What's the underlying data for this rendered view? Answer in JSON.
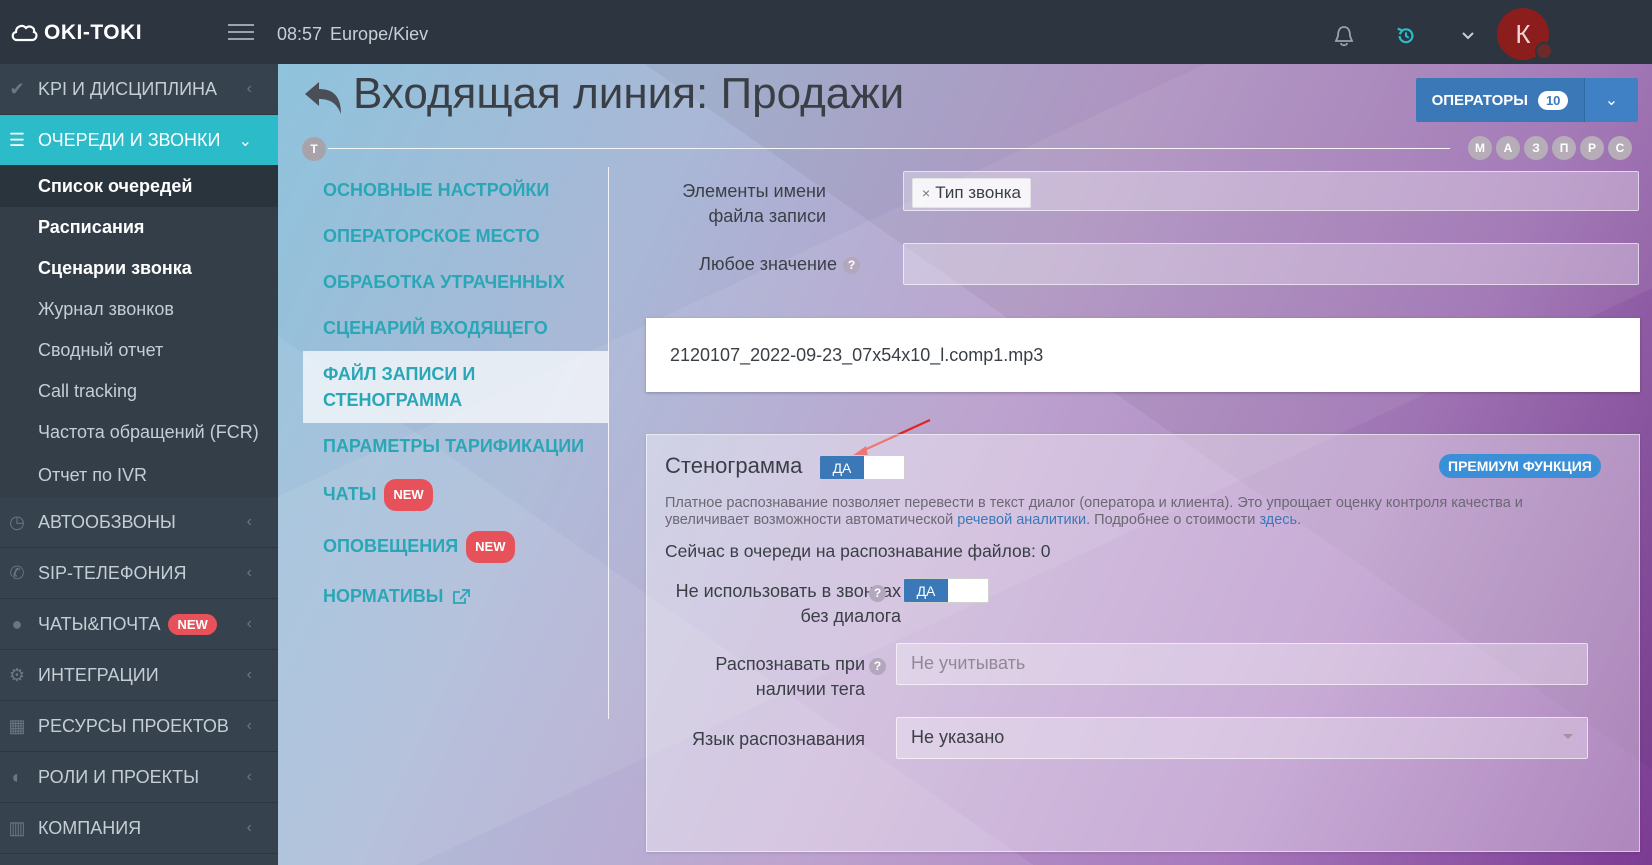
{
  "topbar": {
    "logo": "OKI-TOKI",
    "time": "08:57",
    "timezone": "Europe/Kiev",
    "avatar_letter": "К"
  },
  "sidebar": {
    "sections": [
      {
        "label": "KPI И ДИСЦИПЛИНА",
        "icon": "check-icon"
      },
      {
        "label": "ОЧЕРЕДИ И ЗВОНКИ",
        "icon": "list-icon"
      }
    ],
    "queue_items": [
      {
        "label": "Список очередей"
      },
      {
        "label": "Расписания"
      },
      {
        "label": "Сценарии звонка"
      },
      {
        "label": "Журнал звонков"
      },
      {
        "label": "Сводный отчет"
      },
      {
        "label": "Call tracking"
      },
      {
        "label": "Частота обращений (FCR)"
      },
      {
        "label": "Отчет по IVR"
      }
    ],
    "lower_sections": [
      {
        "label": "АВТООБЗВОНЫ",
        "icon": "clock-icon"
      },
      {
        "label": "SIP-ТЕЛЕФОНИЯ",
        "icon": "phone-icon"
      },
      {
        "label": "ЧАТЫ&ПОЧТА",
        "icon": "chat-icon",
        "badge": "NEW"
      },
      {
        "label": "ИНТЕГРАЦИИ",
        "icon": "gears-icon"
      },
      {
        "label": "РЕСУРСЫ ПРОЕКТОВ",
        "icon": "grid-icon"
      },
      {
        "label": "РОЛИ И ПРОЕКТЫ",
        "icon": "toggle-icon"
      },
      {
        "label": "КОМПАНИЯ",
        "icon": "bar-chart-icon"
      }
    ]
  },
  "page": {
    "title": "Входящая линия: Продажи",
    "t_label": "Т",
    "letters": [
      "М",
      "А",
      "З",
      "П",
      "Р",
      "С"
    ],
    "operators_label": "ОПЕРАТОРЫ",
    "operators_count": "10"
  },
  "settings_nav": {
    "items": [
      {
        "label": "ОСНОВНЫЕ НАСТРОЙКИ"
      },
      {
        "label": "ОПЕРАТОРСКОЕ МЕСТО"
      },
      {
        "label": "ОБРАБОТКА УТРАЧЕННЫХ"
      },
      {
        "label": "СЦЕНАРИЙ ВХОДЯЩЕГО"
      },
      {
        "label": "ФАЙЛ ЗАПИСИ И СТЕНОГРАММА"
      },
      {
        "label": "ПАРАМЕТРЫ ТАРИФИКАЦИИ"
      },
      {
        "label": "ЧАТЫ",
        "badge": "NEW"
      },
      {
        "label": "ОПОВЕЩЕНИЯ",
        "badge": "NEW"
      },
      {
        "label": "НОРМАТИВЫ"
      }
    ]
  },
  "form": {
    "filename_elements_label": "Элементы имени файла записи",
    "filename_tag": "Тип звонка",
    "any_value_label": "Любое значение",
    "filename_example": "2120107_2022-09-23_07x54x10_l.comp1.mp3"
  },
  "steno": {
    "title": "Стенограмма",
    "toggle_on": "ДА",
    "premium": "ПРЕМИУМ ФУНКЦИЯ",
    "desc_part1": "Платное распознавание позволяет перевести в текст диалог (оператора и клиента). Это упрощает оценку контроля качества и увеличивает возможности автоматической ",
    "desc_link1": "речевой аналитики",
    "desc_part2": ". Подробнее о стоимости ",
    "desc_link2": "здесь",
    "desc_part3": ".",
    "queue_text": "Сейчас в очереди на распознавание файлов: 0",
    "no_dialog_label": "Не использовать в звонках без диалога",
    "no_dialog_toggle": "ДА",
    "tag_label": "Распознавать при наличии тега",
    "tag_placeholder": "Не учитывать",
    "lang_label": "Язык распознавания",
    "lang_value": "Не указано"
  },
  "colors": {
    "accent": "#2cbcc9",
    "primary": "#3a78b8",
    "badge": "#e6515a"
  }
}
